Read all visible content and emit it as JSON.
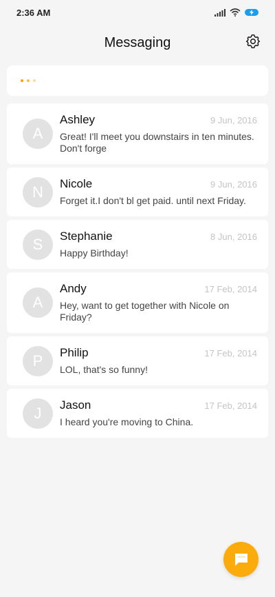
{
  "status_bar": {
    "time": "2:36 AM"
  },
  "header": {
    "title": "Messaging"
  },
  "colors": {
    "accent": "#fbab0b",
    "battery": "#1a9cf0",
    "avatar": "#e2e2e2",
    "date": "#c4c4c4"
  },
  "conversations": [
    {
      "initial": "A",
      "name": "Ashley",
      "date": "9 Jun, 2016",
      "message": "Great! I'll meet you downstairs in ten minutes. Don't forge"
    },
    {
      "initial": "N",
      "name": "Nicole",
      "date": "9 Jun, 2016",
      "message": "Forget it.I don't bl get paid. until next Friday."
    },
    {
      "initial": "S",
      "name": "Stephanie",
      "date": "8 Jun, 2016",
      "message": "Happy Birthday!"
    },
    {
      "initial": "A",
      "name": "Andy",
      "date": "17 Feb, 2014",
      "message": "Hey, want to get together with Nicole on Friday?"
    },
    {
      "initial": "P",
      "name": "Philip",
      "date": "17 Feb, 2014",
      "message": "LOL, that's so funny!"
    },
    {
      "initial": "J",
      "name": "Jason",
      "date": "17 Feb, 2014",
      "message": "I heard you're moving to China."
    }
  ]
}
